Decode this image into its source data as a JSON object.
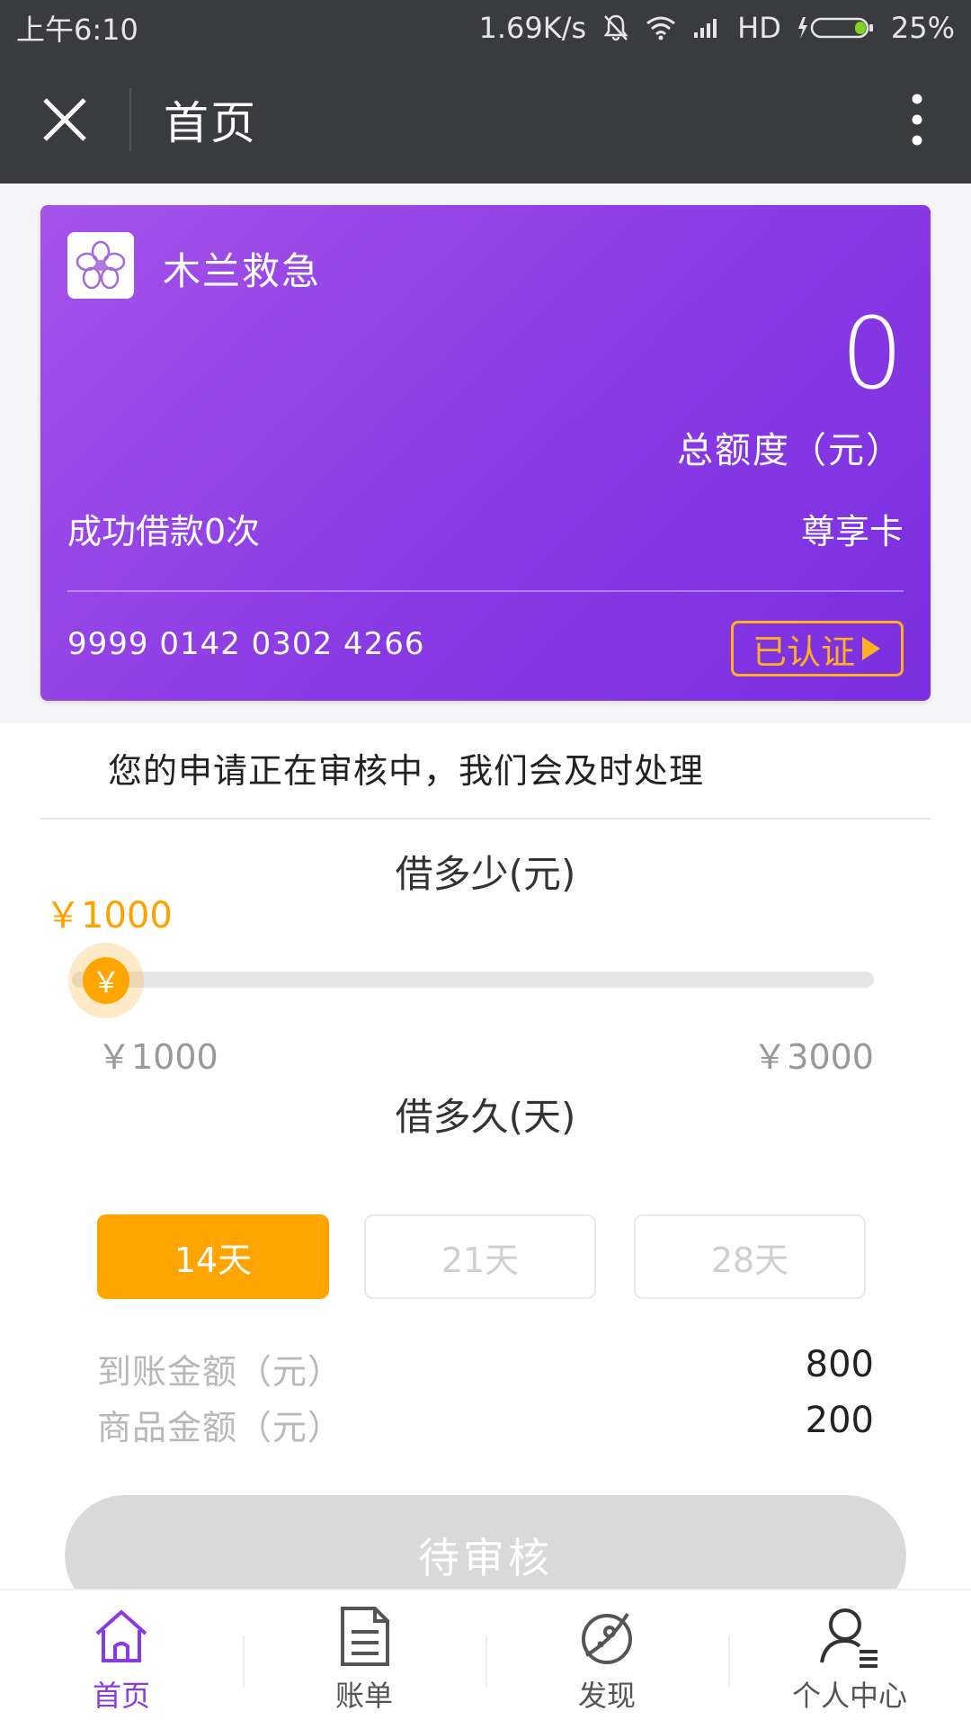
{
  "status_bar": {
    "time": "上午6:10",
    "speed": "1.69K/s",
    "network": "HD",
    "battery": "25%"
  },
  "header": {
    "title": "首页"
  },
  "card": {
    "brand_name": "木兰救急",
    "total_amount": "0",
    "total_label": "总额度（元）",
    "borrow_count": "成功借款0次",
    "tier": "尊享卡",
    "card_number": "9999 0142 0302 4266",
    "verified_label": "已认证"
  },
  "notice": "您的申请正在审核中，我们会及时处理",
  "amount": {
    "title": "借多少(元)",
    "current": "￥1000",
    "min": "￥1000",
    "max": "￥3000",
    "thumb_symbol": "￥",
    "level": 0.0
  },
  "duration": {
    "title": "借多久(天)",
    "options": [
      "14天",
      "21天",
      "28天"
    ],
    "selected": "14天"
  },
  "details": {
    "received_label": "到账金额（元）",
    "received_value": "800",
    "goods_label": "商品金额（元）",
    "goods_value": "200"
  },
  "submit_label": "待审核",
  "bottom_nav": {
    "items": [
      {
        "label": "首页",
        "icon": "home-icon"
      },
      {
        "label": "账单",
        "icon": "bill-icon"
      },
      {
        "label": "发现",
        "icon": "discover-icon"
      },
      {
        "label": "个人中心",
        "icon": "user-icon"
      }
    ]
  },
  "colors": {
    "accent_purple": "#8a3ae4",
    "accent_orange": "#ffa400",
    "header_bg": "#3a3b3e"
  }
}
